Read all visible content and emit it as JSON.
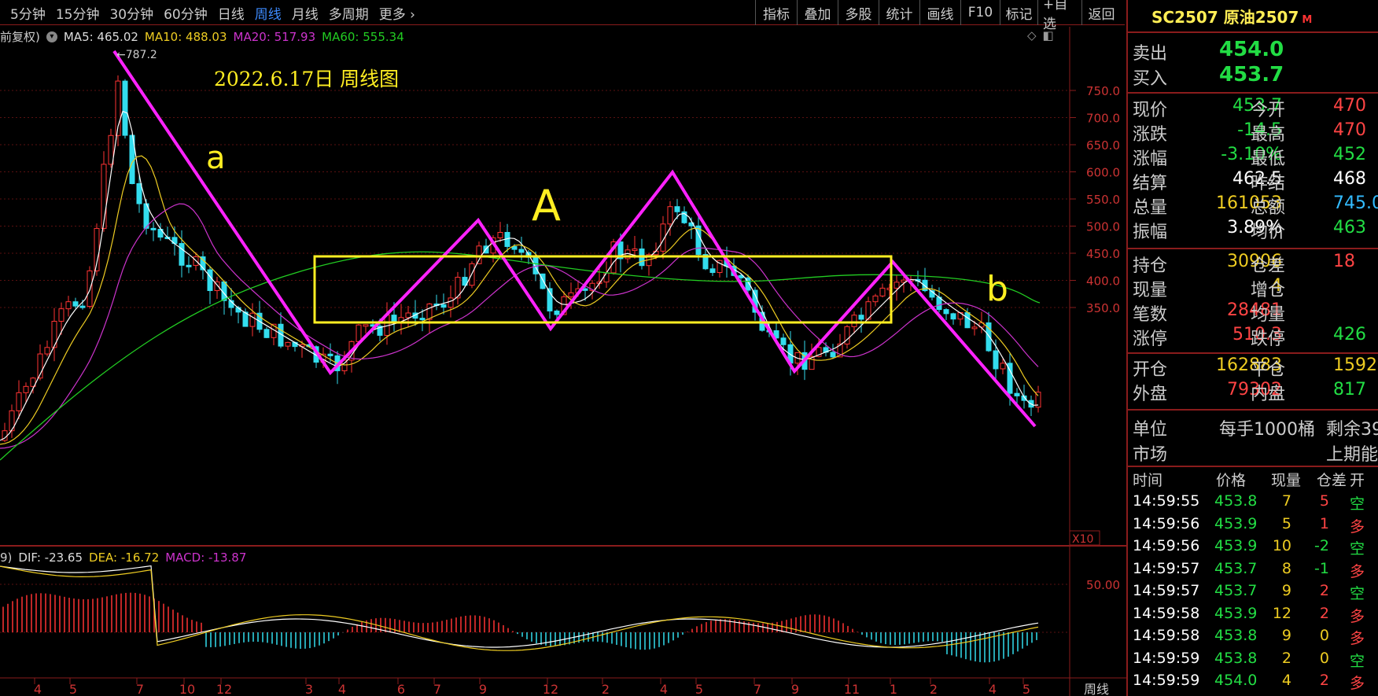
{
  "toolbar": {
    "left_tabs": [
      "5分钟",
      "15分钟",
      "30分钟",
      "60分钟",
      "日线",
      "周线",
      "月线",
      "多周期",
      "更多"
    ],
    "active_tab": "周线",
    "right_buttons": [
      "指标",
      "叠加",
      "多股",
      "统计",
      "画线",
      "F10",
      "标记",
      "+自选",
      "返回"
    ]
  },
  "ma_legend": {
    "prefix": "前复权)",
    "ma5": "MA5: 465.02",
    "ma10": "MA10: 488.03",
    "ma20": "MA20: 517.93",
    "ma60": "MA60: 555.34"
  },
  "annotations": {
    "date_title": "2022.6.17日    周线图",
    "high_marker": "787.2",
    "wave_a": "a",
    "wave_A": "A",
    "wave_b": "b"
  },
  "price_axis": [
    "750.0",
    "700.0",
    "650.0",
    "600.0",
    "550.0",
    "500.0",
    "450.0",
    "400.0",
    "350.0"
  ],
  "zoom": "X10",
  "macd_legend": {
    "prefix": "9)",
    "dif": "DIF: -23.65",
    "dea": "DEA: -16.72",
    "macd": "MACD: -13.87"
  },
  "macd_axis": "50.00",
  "time_axis": [
    "4",
    "5",
    "7",
    "10",
    "12",
    "3",
    "4",
    "6",
    "7",
    "9",
    "12",
    "2",
    "4",
    "5",
    "7",
    "9",
    "11",
    "1",
    "2",
    "4",
    "5"
  ],
  "period_label": "周线",
  "quote": {
    "title": "SC2507 原油2507",
    "title_suffix": "M",
    "sell_label": "卖出",
    "sell_price": "454.0",
    "buy_label": "买入",
    "buy_price": "453.7",
    "rows": [
      {
        "l1": "现价",
        "v1": "453.7",
        "c1": "green",
        "l2": "今开",
        "v2": "470",
        "c2": "red"
      },
      {
        "l1": "涨跌",
        "v1": "-14.5",
        "c1": "green",
        "l2": "最高",
        "v2": "470",
        "c2": "red"
      },
      {
        "l1": "涨幅",
        "v1": "-3.10%",
        "c1": "green",
        "l2": "最低",
        "v2": "452",
        "c2": "green"
      },
      {
        "l1": "结算",
        "v1": "462.5",
        "c1": "white",
        "l2": "昨结",
        "v2": "468",
        "c2": "white"
      },
      {
        "l1": "总量",
        "v1": "161053",
        "c1": "yellow",
        "l2": "总额",
        "v2": "745.0",
        "c2": "cyan"
      },
      {
        "l1": "振幅",
        "v1": "3.89%",
        "c1": "white",
        "l2": "均价",
        "v2": "463",
        "c2": "green"
      }
    ],
    "rows2": [
      {
        "l1": "持仓",
        "v1": "30906",
        "c1": "yellow",
        "l2": "仓差",
        "v2": "18",
        "c2": "red"
      },
      {
        "l1": "现量",
        "v1": "4",
        "c1": "yellow",
        "l2": "增仓",
        "v2": "",
        "c2": "red"
      },
      {
        "l1": "笔数",
        "v1": "28481",
        "c1": "red",
        "l2": "均量",
        "v2": "",
        "c2": "red"
      },
      {
        "l1": "涨停",
        "v1": "510.3",
        "c1": "red",
        "l2": "跌停",
        "v2": "426",
        "c2": "green"
      }
    ],
    "rows3": [
      {
        "l1": "开仓",
        "v1": "162883",
        "c1": "yellow",
        "l2": "平仓",
        "v2": "1592",
        "c2": "yellow"
      },
      {
        "l1": "外盘",
        "v1": "79302",
        "c1": "red",
        "l2": "内盘",
        "v2": "817",
        "c2": "green"
      }
    ],
    "unit_label": "单位",
    "unit_value": "每手1000桶",
    "remain": "剩余39",
    "market_label": "市场",
    "market_value": "上期能",
    "ticks_header": [
      "时间",
      "价格",
      "现量",
      "仓差",
      "开"
    ],
    "ticks": [
      {
        "t": "14:59:55",
        "p": "453.8",
        "v": "7",
        "d": "5",
        "k": "空"
      },
      {
        "t": "14:59:56",
        "p": "453.9",
        "v": "5",
        "d": "1",
        "k": "多"
      },
      {
        "t": "14:59:56",
        "p": "453.9",
        "v": "10",
        "d": "-2",
        "k": "空"
      },
      {
        "t": "14:59:57",
        "p": "453.7",
        "v": "8",
        "d": "-1",
        "k": "多"
      },
      {
        "t": "14:59:57",
        "p": "453.7",
        "v": "9",
        "d": "2",
        "k": "空"
      },
      {
        "t": "14:59:58",
        "p": "453.9",
        "v": "12",
        "d": "2",
        "k": "多"
      },
      {
        "t": "14:59:58",
        "p": "453.8",
        "v": "9",
        "d": "0",
        "k": "多"
      },
      {
        "t": "14:59:59",
        "p": "453.8",
        "v": "2",
        "d": "0",
        "k": "空"
      },
      {
        "t": "14:59:59",
        "p": "454.0",
        "v": "4",
        "d": "2",
        "k": "多"
      }
    ]
  },
  "colors": {
    "up": "#ff3333",
    "down": "#33ddee",
    "ma5": "#ffffff",
    "ma10": "#eecc22",
    "ma20": "#cc33cc",
    "ma60": "#22cc22",
    "annot": "#ff22ff",
    "box": "#ffee22"
  }
}
